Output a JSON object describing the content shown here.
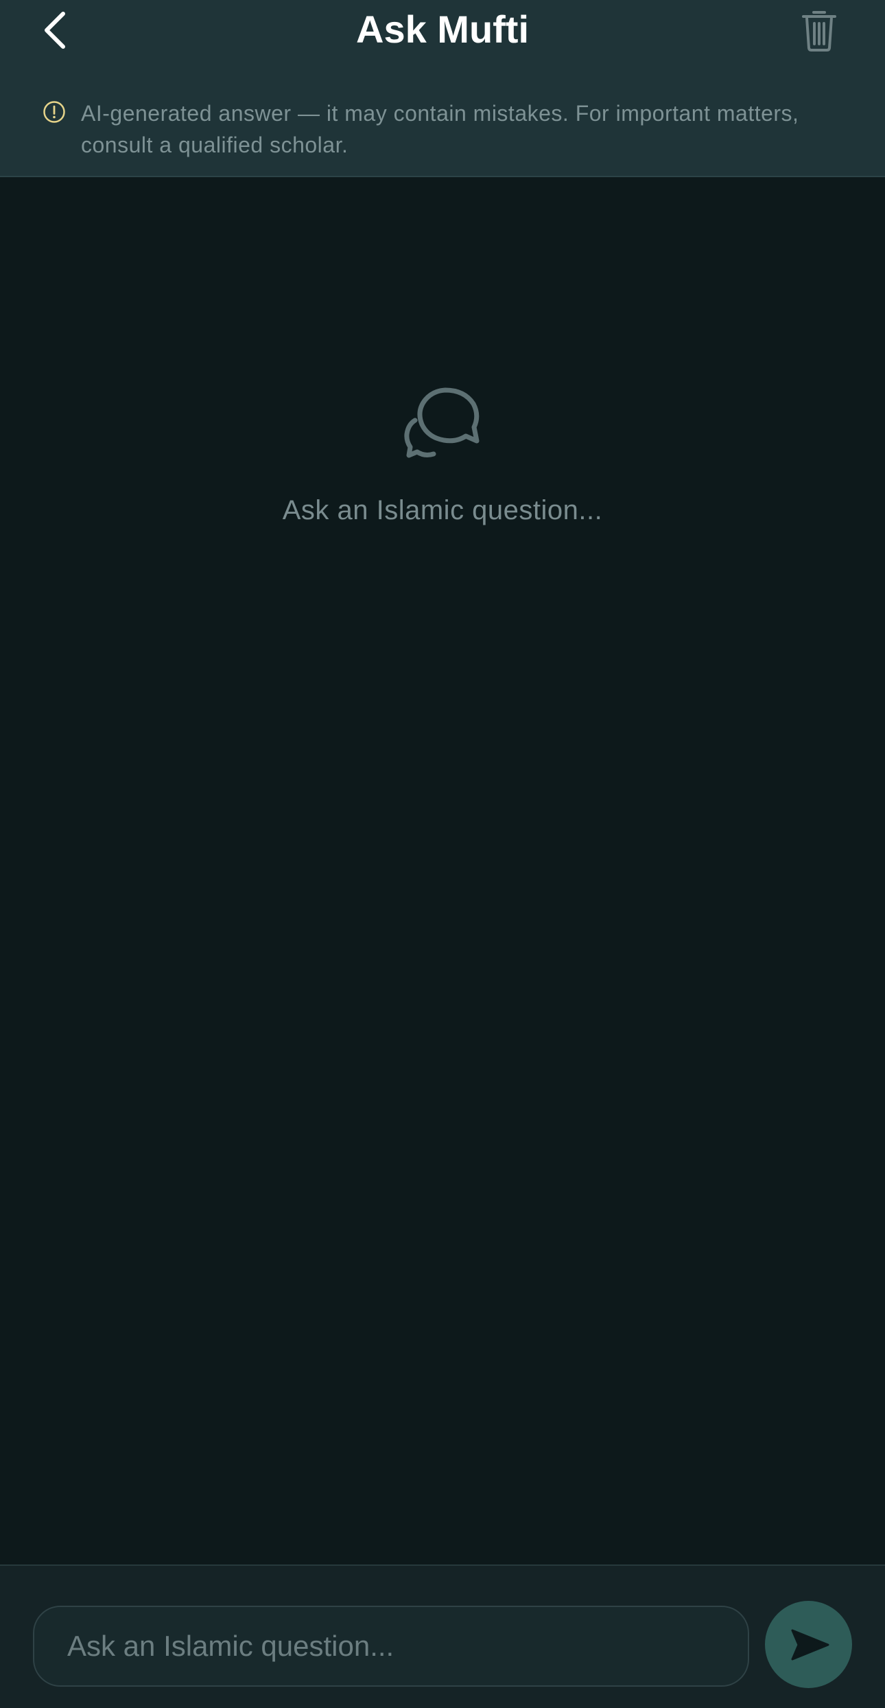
{
  "header": {
    "title": "Ask Mufti",
    "back_icon": "chevron-left-icon",
    "delete_icon": "trash-icon",
    "disclaimer": "AI-generated answer — it may contain mistakes. For important matters, consult a qualified scholar.",
    "disclaimer_icon": "warning-icon"
  },
  "empty_state": {
    "icon": "chat-bubbles-icon",
    "message": "Ask an Islamic question..."
  },
  "composer": {
    "input_value": "",
    "placeholder": "Ask an Islamic question...",
    "send_icon": "send-icon"
  },
  "colors": {
    "background": "#0d191b",
    "header": "#1f3438",
    "accent": "#2e5c58",
    "warning": "#e6d48a"
  }
}
